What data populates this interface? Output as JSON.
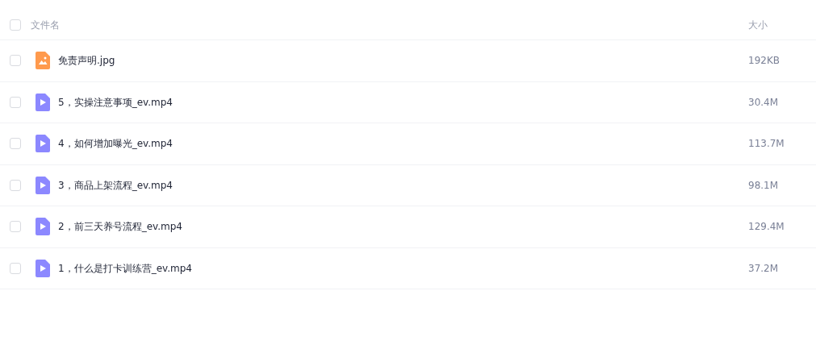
{
  "table": {
    "columns": [
      {
        "label": "文件名"
      },
      {
        "label": "大小"
      }
    ],
    "header_checkbox": {
      "checked": false
    },
    "rows": [
      {
        "kind": "image",
        "name": "免责声明.jpg",
        "size": "192KB",
        "checked": false
      },
      {
        "kind": "video",
        "name": "5，实操注意事项_ev.mp4",
        "size": "30.4M",
        "checked": false
      },
      {
        "kind": "video",
        "name": "4，如何增加曝光_ev.mp4",
        "size": "113.7M",
        "checked": false
      },
      {
        "kind": "video",
        "name": "3，商品上架流程_ev.mp4",
        "size": "98.1M",
        "checked": false
      },
      {
        "kind": "video",
        "name": "2，前三天养号流程_ev.mp4",
        "size": "129.4M",
        "checked": false
      },
      {
        "kind": "video",
        "name": "1，什么是打卡训练营_ev.mp4",
        "size": "37.2M",
        "checked": false
      }
    ]
  }
}
